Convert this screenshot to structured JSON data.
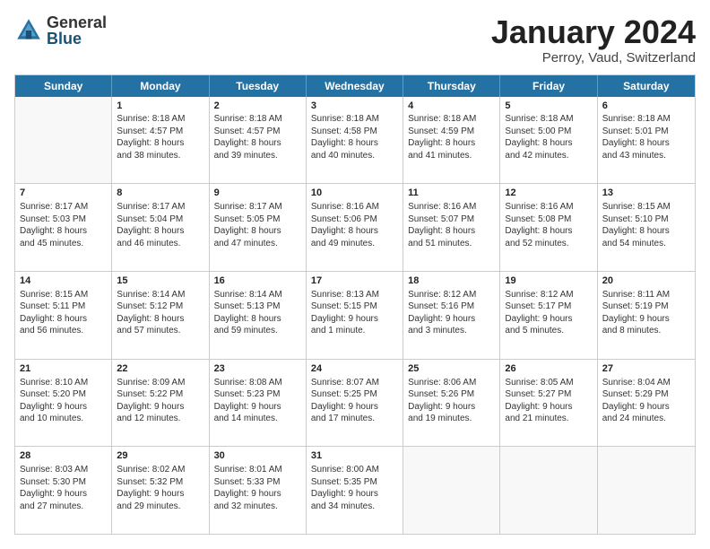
{
  "logo": {
    "general": "General",
    "blue": "Blue"
  },
  "title": "January 2024",
  "subtitle": "Perroy, Vaud, Switzerland",
  "headers": [
    "Sunday",
    "Monday",
    "Tuesday",
    "Wednesday",
    "Thursday",
    "Friday",
    "Saturday"
  ],
  "weeks": [
    [
      {
        "day": null,
        "lines": []
      },
      {
        "day": "1",
        "lines": [
          "Sunrise: 8:18 AM",
          "Sunset: 4:57 PM",
          "Daylight: 8 hours",
          "and 38 minutes."
        ]
      },
      {
        "day": "2",
        "lines": [
          "Sunrise: 8:18 AM",
          "Sunset: 4:57 PM",
          "Daylight: 8 hours",
          "and 39 minutes."
        ]
      },
      {
        "day": "3",
        "lines": [
          "Sunrise: 8:18 AM",
          "Sunset: 4:58 PM",
          "Daylight: 8 hours",
          "and 40 minutes."
        ]
      },
      {
        "day": "4",
        "lines": [
          "Sunrise: 8:18 AM",
          "Sunset: 4:59 PM",
          "Daylight: 8 hours",
          "and 41 minutes."
        ]
      },
      {
        "day": "5",
        "lines": [
          "Sunrise: 8:18 AM",
          "Sunset: 5:00 PM",
          "Daylight: 8 hours",
          "and 42 minutes."
        ]
      },
      {
        "day": "6",
        "lines": [
          "Sunrise: 8:18 AM",
          "Sunset: 5:01 PM",
          "Daylight: 8 hours",
          "and 43 minutes."
        ]
      }
    ],
    [
      {
        "day": "7",
        "lines": [
          "Sunrise: 8:17 AM",
          "Sunset: 5:03 PM",
          "Daylight: 8 hours",
          "and 45 minutes."
        ]
      },
      {
        "day": "8",
        "lines": [
          "Sunrise: 8:17 AM",
          "Sunset: 5:04 PM",
          "Daylight: 8 hours",
          "and 46 minutes."
        ]
      },
      {
        "day": "9",
        "lines": [
          "Sunrise: 8:17 AM",
          "Sunset: 5:05 PM",
          "Daylight: 8 hours",
          "and 47 minutes."
        ]
      },
      {
        "day": "10",
        "lines": [
          "Sunrise: 8:16 AM",
          "Sunset: 5:06 PM",
          "Daylight: 8 hours",
          "and 49 minutes."
        ]
      },
      {
        "day": "11",
        "lines": [
          "Sunrise: 8:16 AM",
          "Sunset: 5:07 PM",
          "Daylight: 8 hours",
          "and 51 minutes."
        ]
      },
      {
        "day": "12",
        "lines": [
          "Sunrise: 8:16 AM",
          "Sunset: 5:08 PM",
          "Daylight: 8 hours",
          "and 52 minutes."
        ]
      },
      {
        "day": "13",
        "lines": [
          "Sunrise: 8:15 AM",
          "Sunset: 5:10 PM",
          "Daylight: 8 hours",
          "and 54 minutes."
        ]
      }
    ],
    [
      {
        "day": "14",
        "lines": [
          "Sunrise: 8:15 AM",
          "Sunset: 5:11 PM",
          "Daylight: 8 hours",
          "and 56 minutes."
        ]
      },
      {
        "day": "15",
        "lines": [
          "Sunrise: 8:14 AM",
          "Sunset: 5:12 PM",
          "Daylight: 8 hours",
          "and 57 minutes."
        ]
      },
      {
        "day": "16",
        "lines": [
          "Sunrise: 8:14 AM",
          "Sunset: 5:13 PM",
          "Daylight: 8 hours",
          "and 59 minutes."
        ]
      },
      {
        "day": "17",
        "lines": [
          "Sunrise: 8:13 AM",
          "Sunset: 5:15 PM",
          "Daylight: 9 hours",
          "and 1 minute."
        ]
      },
      {
        "day": "18",
        "lines": [
          "Sunrise: 8:12 AM",
          "Sunset: 5:16 PM",
          "Daylight: 9 hours",
          "and 3 minutes."
        ]
      },
      {
        "day": "19",
        "lines": [
          "Sunrise: 8:12 AM",
          "Sunset: 5:17 PM",
          "Daylight: 9 hours",
          "and 5 minutes."
        ]
      },
      {
        "day": "20",
        "lines": [
          "Sunrise: 8:11 AM",
          "Sunset: 5:19 PM",
          "Daylight: 9 hours",
          "and 8 minutes."
        ]
      }
    ],
    [
      {
        "day": "21",
        "lines": [
          "Sunrise: 8:10 AM",
          "Sunset: 5:20 PM",
          "Daylight: 9 hours",
          "and 10 minutes."
        ]
      },
      {
        "day": "22",
        "lines": [
          "Sunrise: 8:09 AM",
          "Sunset: 5:22 PM",
          "Daylight: 9 hours",
          "and 12 minutes."
        ]
      },
      {
        "day": "23",
        "lines": [
          "Sunrise: 8:08 AM",
          "Sunset: 5:23 PM",
          "Daylight: 9 hours",
          "and 14 minutes."
        ]
      },
      {
        "day": "24",
        "lines": [
          "Sunrise: 8:07 AM",
          "Sunset: 5:25 PM",
          "Daylight: 9 hours",
          "and 17 minutes."
        ]
      },
      {
        "day": "25",
        "lines": [
          "Sunrise: 8:06 AM",
          "Sunset: 5:26 PM",
          "Daylight: 9 hours",
          "and 19 minutes."
        ]
      },
      {
        "day": "26",
        "lines": [
          "Sunrise: 8:05 AM",
          "Sunset: 5:27 PM",
          "Daylight: 9 hours",
          "and 21 minutes."
        ]
      },
      {
        "day": "27",
        "lines": [
          "Sunrise: 8:04 AM",
          "Sunset: 5:29 PM",
          "Daylight: 9 hours",
          "and 24 minutes."
        ]
      }
    ],
    [
      {
        "day": "28",
        "lines": [
          "Sunrise: 8:03 AM",
          "Sunset: 5:30 PM",
          "Daylight: 9 hours",
          "and 27 minutes."
        ]
      },
      {
        "day": "29",
        "lines": [
          "Sunrise: 8:02 AM",
          "Sunset: 5:32 PM",
          "Daylight: 9 hours",
          "and 29 minutes."
        ]
      },
      {
        "day": "30",
        "lines": [
          "Sunrise: 8:01 AM",
          "Sunset: 5:33 PM",
          "Daylight: 9 hours",
          "and 32 minutes."
        ]
      },
      {
        "day": "31",
        "lines": [
          "Sunrise: 8:00 AM",
          "Sunset: 5:35 PM",
          "Daylight: 9 hours",
          "and 34 minutes."
        ]
      },
      {
        "day": null,
        "lines": []
      },
      {
        "day": null,
        "lines": []
      },
      {
        "day": null,
        "lines": []
      }
    ]
  ]
}
